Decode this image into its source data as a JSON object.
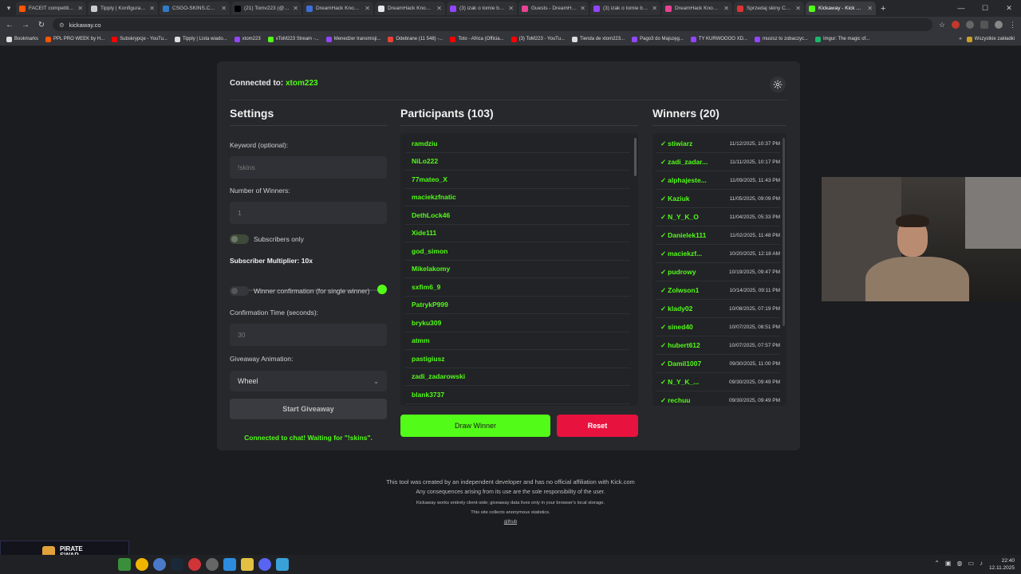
{
  "browser": {
    "tabs": [
      {
        "label": "FACEIT competitive m...",
        "color": "#ff5500",
        "active": false
      },
      {
        "label": "Tipply | Konfigurator |...",
        "color": "#cccccc",
        "active": false
      },
      {
        "label": "CSGO-SKINS.COM - B...",
        "color": "#2f7cc8",
        "active": false
      },
      {
        "label": "(21) Tomv223 (@Tom...",
        "color": "#000000",
        "active": false
      },
      {
        "label": "DreamHack Knockout...",
        "color": "#3e6fd8",
        "active": false
      },
      {
        "label": "DreamHack Knockout...",
        "color": "#e8e8e8",
        "active": false
      },
      {
        "label": "(3) izak o tomie beka...",
        "color": "#9146ff",
        "active": false
      },
      {
        "label": "Guests - DreamHack S...",
        "color": "#e84393",
        "active": false
      },
      {
        "label": "(3) izak o tomie beka...",
        "color": "#9146ff",
        "active": false
      },
      {
        "label": "DreamHack Knockout...",
        "color": "#e84393",
        "active": false
      },
      {
        "label": "Sprzedaj skiny CS2 (C...",
        "color": "#d33",
        "active": false
      },
      {
        "label": "Kickaway - Kick Givea...",
        "color": "#53fc18",
        "active": true
      }
    ],
    "url": "kickaway.co",
    "bookmarks": [
      {
        "label": "Bookmarks",
        "color": "#dddddd"
      },
      {
        "label": "PPL PRO WEEK by H...",
        "color": "#ff5500"
      },
      {
        "label": "Subskrypcje - YouTu...",
        "color": "#ff0000"
      },
      {
        "label": "Tipply | Lista wiado...",
        "color": "#dddddd"
      },
      {
        "label": "xtom223",
        "color": "#9146ff"
      },
      {
        "label": "xToM223 Stream -...",
        "color": "#53fc18"
      },
      {
        "label": "Menedżer transmisji...",
        "color": "#9146ff"
      },
      {
        "label": "Odebrane (11 548) -...",
        "color": "#ea4335"
      },
      {
        "label": "Toto - Africa (Officia...",
        "color": "#ff0000"
      },
      {
        "label": "(3) ToM223 - YouTu...",
        "color": "#ff0000"
      },
      {
        "label": "Tienda de xtom223...",
        "color": "#dddddd"
      },
      {
        "label": "Pago3 do Majszęg...",
        "color": "#9146ff"
      },
      {
        "label": "TY KURWOOOO XD...",
        "color": "#9146ff"
      },
      {
        "label": "musisz to zobaczyc...",
        "color": "#9146ff"
      },
      {
        "label": "Imgur: The magic of...",
        "color": "#1bb76e"
      }
    ],
    "bookmarks_folder": "Wszystkie zakładki"
  },
  "app": {
    "connected_prefix": "Connected to:",
    "connected_user": "xtom223",
    "settings": {
      "title": "Settings",
      "keyword_label": "Keyword (optional):",
      "keyword_placeholder": "!skins",
      "winners_label": "Number of Winners:",
      "winners_value": "1",
      "subscribers_only_label": "Subscribers only",
      "multiplier_label": "Subscriber Multiplier: 10x",
      "multiplier_value": 10,
      "confirmation_label": "Winner confirmation (for single winner)",
      "confirmation_time_label": "Confirmation Time (seconds):",
      "confirmation_time_value": "30",
      "animation_label": "Giveaway Animation:",
      "animation_value": "Wheel",
      "start_button": "Start Giveaway",
      "status": "Connected to chat! Waiting for \"!skins\"."
    },
    "participants": {
      "title": "Participants (103)",
      "items": [
        "ramdziu",
        "NiLo222",
        "77mateo_X",
        "maciekzfnatic",
        "DethLock46",
        "Xide111",
        "god_simon",
        "Mikelakomy",
        "sxfim6_9",
        "PatrykP999",
        "bryku309",
        "atmm",
        "pastigiusz",
        "zadi_zadarowski",
        "blank3737"
      ]
    },
    "winners": {
      "title": "Winners (20)",
      "items": [
        {
          "name": "stiwiarz",
          "date": "11/12/2025, 10:37 PM"
        },
        {
          "name": "zadi_zadar...",
          "date": "11/11/2025, 10:17 PM"
        },
        {
          "name": "alphajeste...",
          "date": "11/09/2025, 11:43 PM"
        },
        {
          "name": "Kaziuk",
          "date": "11/05/2025, 09:09 PM"
        },
        {
          "name": "N_Y_K_O",
          "date": "11/04/2025, 05:33 PM"
        },
        {
          "name": "Danielek111",
          "date": "11/02/2025, 11:48 PM"
        },
        {
          "name": "maciekzf...",
          "date": "10/20/2025, 12:18 AM"
        },
        {
          "name": "pudrowy",
          "date": "10/19/2025, 09:47 PM"
        },
        {
          "name": "Zolwson1",
          "date": "10/14/2025, 09:11 PM"
        },
        {
          "name": "klady02",
          "date": "10/08/2025, 07:19 PM"
        },
        {
          "name": "sined40",
          "date": "10/07/2025, 08:51 PM"
        },
        {
          "name": "hubert612",
          "date": "10/07/2025, 07:57 PM"
        },
        {
          "name": "Damil1007",
          "date": "09/30/2025, 11:00 PM"
        },
        {
          "name": "N_Y_K_...",
          "date": "09/30/2025, 09:49 PM"
        },
        {
          "name": "rechuu",
          "date": "09/30/2025, 09:49 PM"
        }
      ]
    },
    "draw_button": "Draw Winner",
    "reset_button": "Reset",
    "footer": {
      "line1": "This tool was created by an independent developer and has no official affiliation with Kick.com",
      "line2": "Any consequences arising from its use are the sole responsibility of the user.",
      "line3": "Kickaway works entirely client-side; giveaway data lives only in your browser's local storage.",
      "line4": "This site collects anonymous statistics.",
      "link": "github"
    },
    "accent": "#53fc18",
    "danger": "#e8123f"
  },
  "overlay": {
    "promo_line1": "PIRATE",
    "promo_line2": "SWAP"
  },
  "taskbar": {
    "time": "22:40",
    "date": "12.11.2025"
  }
}
